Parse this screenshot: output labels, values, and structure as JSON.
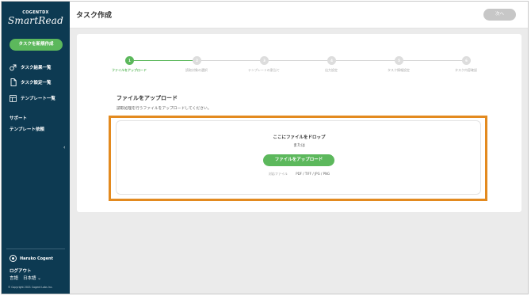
{
  "sidebar": {
    "brand_top": "COGENTDX",
    "brand_main": "SmartRead",
    "new_task_label": "タスクを新規作成",
    "nav": [
      {
        "label": "タスク結果一覧",
        "icon": "task-results-icon"
      },
      {
        "label": "タスク設定一覧",
        "icon": "document-icon"
      },
      {
        "label": "テンプレート一覧",
        "icon": "template-icon"
      }
    ],
    "support_label": "サポート",
    "template_request_label": "テンプレート依頼",
    "collapse_glyph": "‹",
    "user_name": "Haruko Cogent",
    "logout_label": "ログアウト",
    "language_label": "言語",
    "language_value": "日本語 ⌄",
    "copyright": "© Copyright 2021 Cogent Labs Inc."
  },
  "header": {
    "title": "タスク作成",
    "next_label": "次へ"
  },
  "stepper": {
    "steps": [
      {
        "num": "1",
        "label": "ファイルをアップロード",
        "active": true
      },
      {
        "num": "2",
        "label": "読取対象の選択",
        "active": false
      },
      {
        "num": "3",
        "label": "テンプレートの割当て",
        "active": false
      },
      {
        "num": "4",
        "label": "出力設定",
        "active": false
      },
      {
        "num": "5",
        "label": "タスク情報設定",
        "active": false
      },
      {
        "num": "6",
        "label": "タスク内容確認",
        "active": false
      }
    ]
  },
  "main": {
    "section_title": "ファイルをアップロード",
    "section_desc": "読取処理を行うファイルをアップロードしてください。",
    "drop_title": "ここにファイルをドロップ",
    "drop_or": "または",
    "upload_label": "ファイルをアップロード",
    "supported_label": "対応ファイル",
    "supported_types": "PDF / TIFF / JPG / PNG"
  },
  "colors": {
    "sidebar_bg": "#0d3a52",
    "accent_green": "#5cb85c",
    "highlight_orange": "#e38a1f",
    "inactive_gray": "#c7c7c7"
  }
}
